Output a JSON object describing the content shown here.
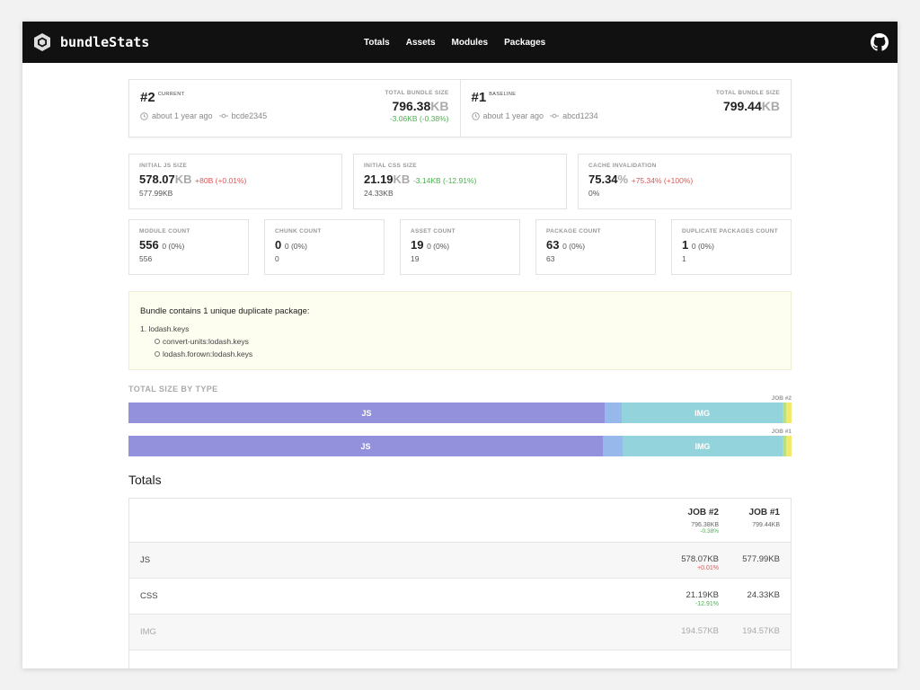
{
  "header": {
    "app_name": "bundleStats",
    "nav": [
      "Totals",
      "Assets",
      "Modules",
      "Packages"
    ],
    "github_icon": "github-icon"
  },
  "jobs": [
    {
      "number": "#2",
      "role": "CURRENT",
      "time": "about 1 year ago",
      "commit": "bcde2345",
      "total_label": "TOTAL BUNDLE SIZE",
      "size": "796.38",
      "unit": "KB",
      "delta": "-3.06KB (-0.38%)"
    },
    {
      "number": "#1",
      "role": "BASELINE",
      "time": "about 1 year ago",
      "commit": "abcd1234",
      "total_label": "TOTAL BUNDLE SIZE",
      "size": "799.44",
      "unit": "KB",
      "delta": ""
    }
  ],
  "metrics_top": [
    {
      "label": "INITIAL JS SIZE",
      "value": "578.07",
      "unit": "KB",
      "delta": "+80B (+0.01%)",
      "delta_type": "red",
      "baseline": "577.99KB"
    },
    {
      "label": "INITIAL CSS SIZE",
      "value": "21.19",
      "unit": "KB",
      "delta": "-3.14KB (-12.91%)",
      "delta_type": "green",
      "baseline": "24.33KB"
    },
    {
      "label": "CACHE INVALIDATION",
      "value": "75.34",
      "unit": "%",
      "delta": "+75.34% (+100%)",
      "delta_type": "red",
      "baseline": "0%"
    }
  ],
  "metrics_bottom": [
    {
      "label": "MODULE COUNT",
      "value": "556",
      "delta": "0 (0%)",
      "baseline": "556"
    },
    {
      "label": "CHUNK COUNT",
      "value": "0",
      "delta": "0 (0%)",
      "baseline": "0"
    },
    {
      "label": "ASSET COUNT",
      "value": "19",
      "delta": "0 (0%)",
      "baseline": "19"
    },
    {
      "label": "PACKAGE COUNT",
      "value": "63",
      "delta": "0 (0%)",
      "baseline": "63"
    },
    {
      "label": "DUPLICATE PACKAGES COUNT",
      "value": "1",
      "delta": "0 (0%)",
      "baseline": "1"
    }
  ],
  "duplicates": {
    "title": "Bundle contains 1 unique duplicate package:",
    "package": "1. lodash.keys",
    "paths": [
      "convert-units:lodash.keys",
      "lodash.forown:lodash.keys"
    ]
  },
  "size_by_type": {
    "title": "TOTAL SIZE BY TYPE",
    "colors": {
      "JS": "#9390dc",
      "CSS": "#96b8ea",
      "IMG": "#92d3dc",
      "other1": "#b8e08a",
      "other2": "#f2e86a"
    },
    "bars": [
      {
        "label": "JOB #2",
        "segments": [
          {
            "name": "JS",
            "share": 0.7259,
            "color": "#9390dc",
            "text": "JS"
          },
          {
            "name": "CSS",
            "share": 0.0266,
            "color": "#96b8ea",
            "text": ""
          },
          {
            "name": "IMG",
            "share": 0.2443,
            "color": "#92d3dc",
            "text": "IMG"
          },
          {
            "name": "other1",
            "share": 0.006,
            "color": "#b8e08a",
            "text": ""
          },
          {
            "name": "other2",
            "share": 0.008,
            "color": "#f2e86a",
            "text": ""
          }
        ]
      },
      {
        "label": "JOB #1",
        "segments": [
          {
            "name": "JS",
            "share": 0.723,
            "color": "#9390dc",
            "text": "JS"
          },
          {
            "name": "CSS",
            "share": 0.0304,
            "color": "#96b8ea",
            "text": ""
          },
          {
            "name": "IMG",
            "share": 0.2434,
            "color": "#92d3dc",
            "text": "IMG"
          },
          {
            "name": "other1",
            "share": 0.006,
            "color": "#b8e08a",
            "text": ""
          },
          {
            "name": "other2",
            "share": 0.008,
            "color": "#f2e86a",
            "text": ""
          }
        ]
      }
    ]
  },
  "totals": {
    "title": "Totals",
    "columns": [
      {
        "name": "JOB #2",
        "total": "796.38KB",
        "delta": "-0.38%"
      },
      {
        "name": "JOB #1",
        "total": "799.44KB",
        "delta": ""
      }
    ],
    "rows": [
      {
        "name": "JS",
        "job2": "578.07KB",
        "delta": "+0.01%",
        "delta_type": "red",
        "job1": "577.99KB",
        "muted": false
      },
      {
        "name": "CSS",
        "job2": "21.19KB",
        "delta": "-12.91%",
        "delta_type": "green",
        "job1": "24.33KB",
        "muted": false
      },
      {
        "name": "IMG",
        "job2": "194.57KB",
        "delta": "",
        "delta_type": "",
        "job1": "194.57KB",
        "muted": true
      }
    ]
  }
}
